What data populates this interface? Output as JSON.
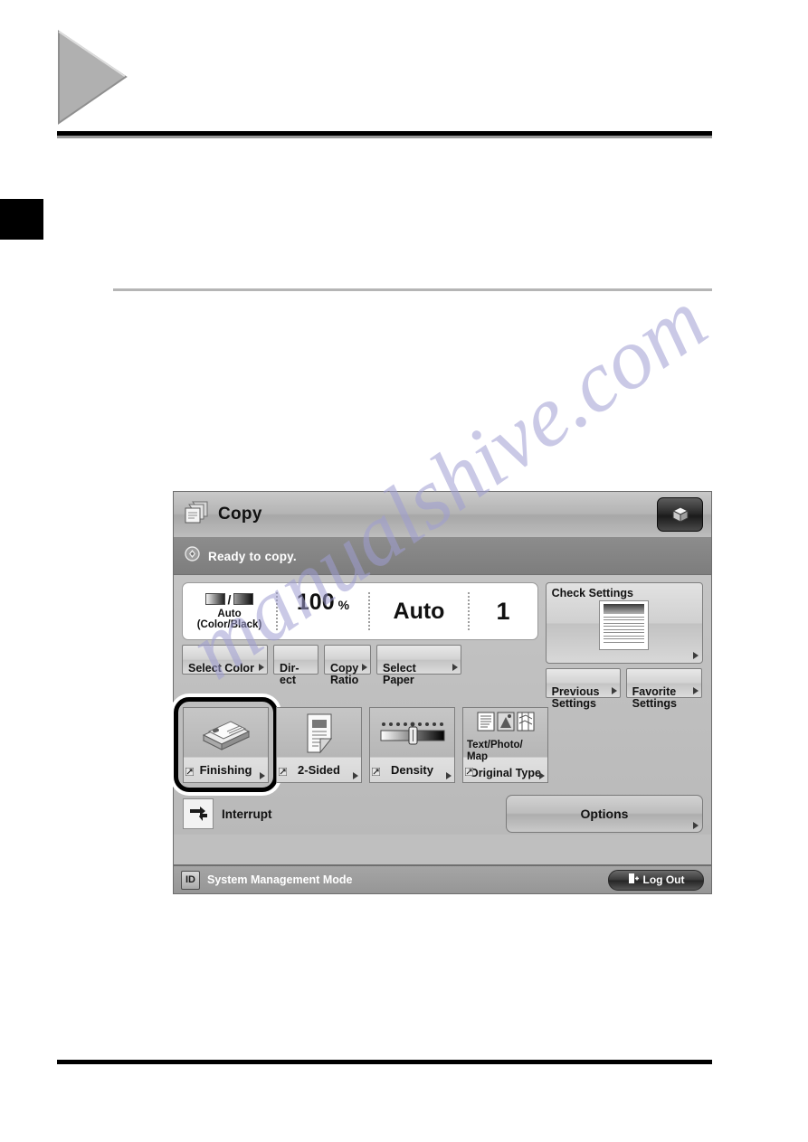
{
  "page": {
    "header_marker": "triangle-marker",
    "chapter_tab": ""
  },
  "panel": {
    "titlebar": {
      "icon": "copy-documents-icon",
      "title": "Copy",
      "right_button_icon": "cube-icon"
    },
    "status": {
      "icon": "status-indicator-icon",
      "text": "Ready to copy."
    },
    "readout": {
      "color_mode": {
        "icon": "color-black-swatch-icon",
        "separator": "/",
        "line1": "Auto",
        "line2": "(Color/Black)"
      },
      "copy_ratio": {
        "value": "100",
        "unit": "%"
      },
      "paper": {
        "value": "Auto"
      },
      "copies": {
        "value": "1"
      }
    },
    "quick_buttons": [
      {
        "name": "select-color-button",
        "label": "Select Color"
      },
      {
        "name": "direct-button",
        "label": "Dir-\nect"
      },
      {
        "name": "copy-ratio-button",
        "label": "Copy\nRatio"
      },
      {
        "name": "select-paper-button",
        "label": "Select Paper"
      }
    ],
    "check_settings": {
      "label": "Check Settings",
      "thumbnail_icon": "document-preview-icon"
    },
    "side_buttons": [
      {
        "name": "previous-settings-button",
        "label": "Previous\nSettings"
      },
      {
        "name": "favorite-settings-button",
        "label": "Favorite\nSettings"
      }
    ],
    "tiles": [
      {
        "name": "finishing-tile",
        "label": "Finishing",
        "sub": "",
        "icon": "finishing-stack-icon",
        "highlighted": true
      },
      {
        "name": "two-sided-tile",
        "label": "2-Sided",
        "sub": "",
        "icon": "two-sided-page-icon",
        "highlighted": false
      },
      {
        "name": "density-tile",
        "label": "Density",
        "sub": "",
        "icon": "density-slider-icon",
        "highlighted": false
      },
      {
        "name": "original-type-tile",
        "label": "Original Type",
        "sub": "Text/Photo/\nMap",
        "icon": "original-type-icon",
        "highlighted": false
      }
    ],
    "interrupt": {
      "label": "Interrupt",
      "icon": "interrupt-icon"
    },
    "options": {
      "label": "Options"
    },
    "footer": {
      "badge": "ID",
      "text": "System Management Mode",
      "logout": {
        "label": "Log Out",
        "icon": "logout-icon"
      }
    }
  },
  "watermark": {
    "text": "manualshive.com"
  },
  "colors": {
    "panel_bg": "#bfbfbf",
    "titlebar": "#b4b4b4",
    "statusbar": "#7d7d7d",
    "footer": "#969696",
    "highlight_ring": "#000000",
    "watermark": "#9f9ed2"
  }
}
